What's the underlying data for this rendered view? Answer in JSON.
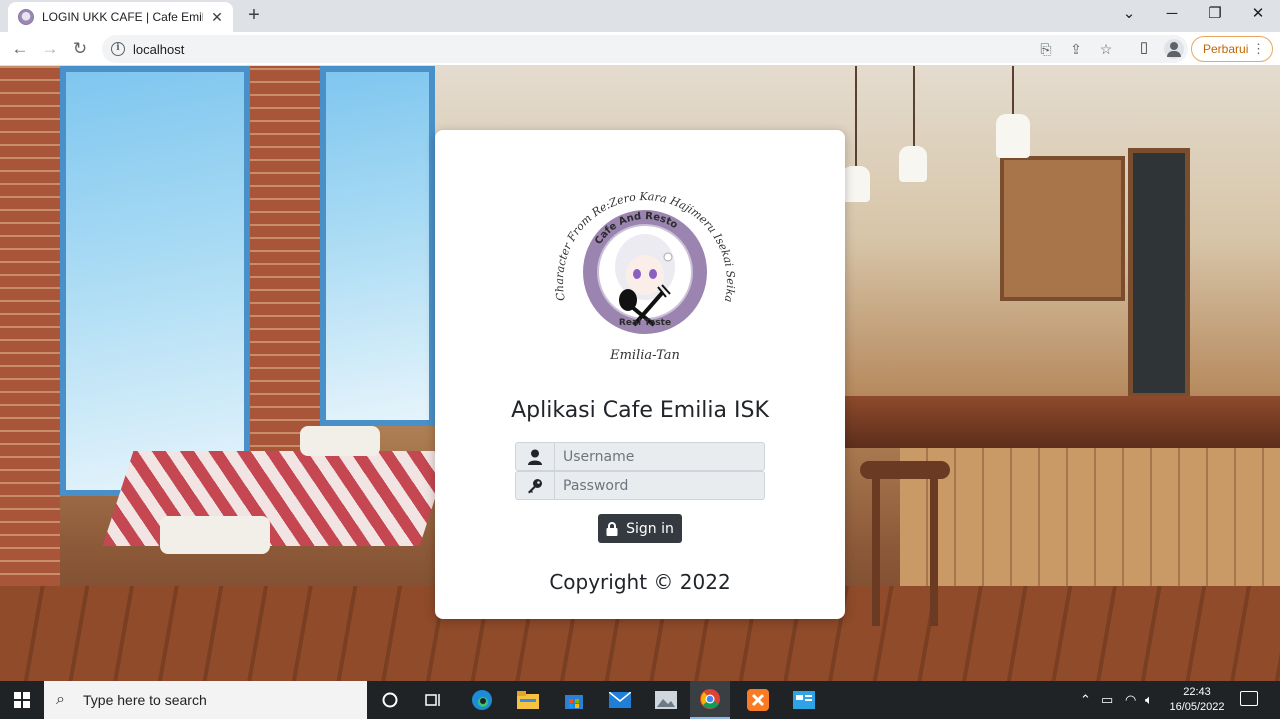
{
  "browser": {
    "tab_title": "LOGIN UKK CAFE | Cafe Emilia ISK",
    "url": "localhost",
    "update_label": "Perbarui"
  },
  "logo": {
    "arc_text": "Character From Re:Zero Kara Hajimeru Isekai Seikatsu",
    "ring_text": "Cafe And Resto",
    "tagline": "Real Taste",
    "signature": "Emilia-Tan"
  },
  "login": {
    "title": "Aplikasi Cafe Emilia ISK",
    "username_placeholder": "Username",
    "password_placeholder": "Password",
    "signin_label": "Sign in",
    "copyright": "Copyright © 2022"
  },
  "taskbar": {
    "search_placeholder": "Type here to search",
    "time": "22:43",
    "date": "16/05/2022"
  },
  "colors": {
    "button_dark": "#343a40",
    "input_bg": "#e9ecef",
    "update_accent": "#c26401",
    "logo_ring": "#9b84b0"
  }
}
